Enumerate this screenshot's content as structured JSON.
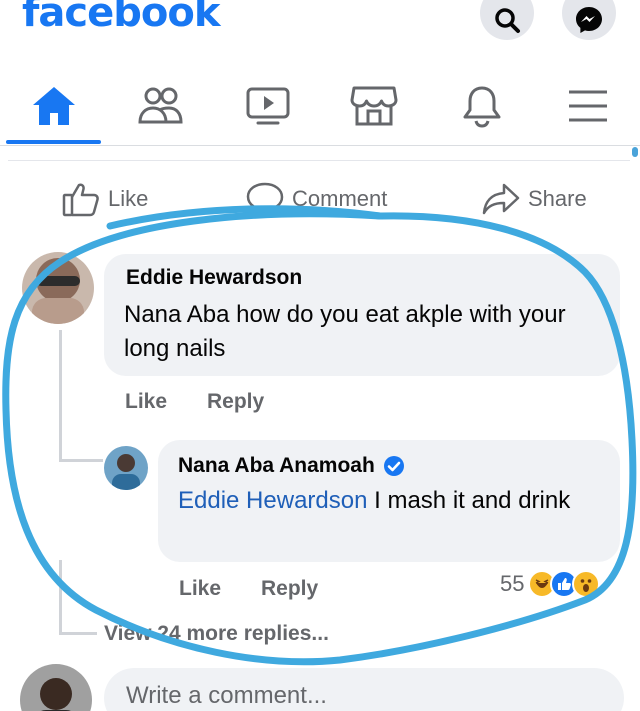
{
  "header": {
    "logo": "facebook",
    "search_icon": "search-icon",
    "messenger_icon": "messenger-icon"
  },
  "nav": {
    "items": [
      {
        "icon": "home-icon",
        "active": true
      },
      {
        "icon": "friends-icon",
        "active": false
      },
      {
        "icon": "watch-icon",
        "active": false
      },
      {
        "icon": "marketplace-icon",
        "active": false
      },
      {
        "icon": "bell-icon",
        "active": false
      },
      {
        "icon": "menu-icon",
        "active": false
      }
    ]
  },
  "actions": {
    "like": "Like",
    "comment": "Comment",
    "share": "Share"
  },
  "comments": {
    "first": {
      "author": "Eddie Hewardson",
      "text": "Nana Aba how do you eat akple with your long nails",
      "like": "Like",
      "reply": "Reply"
    },
    "reply": {
      "author": "Nana Aba Anamoah",
      "verified": true,
      "mention": "Eddie Hewardson",
      "text": " I mash it and drink",
      "like": "Like",
      "reply": "Reply",
      "reaction_count": "55",
      "reaction_icons": [
        "haha-icon",
        "like-icon",
        "wow-icon"
      ]
    },
    "view_more": "View 24 more replies..."
  },
  "composer": {
    "placeholder": "Write a comment..."
  },
  "colors": {
    "brand": "#1877f2",
    "annotation": "#3fa9df",
    "mention": "#1f5fb8",
    "muted": "#65676b"
  }
}
